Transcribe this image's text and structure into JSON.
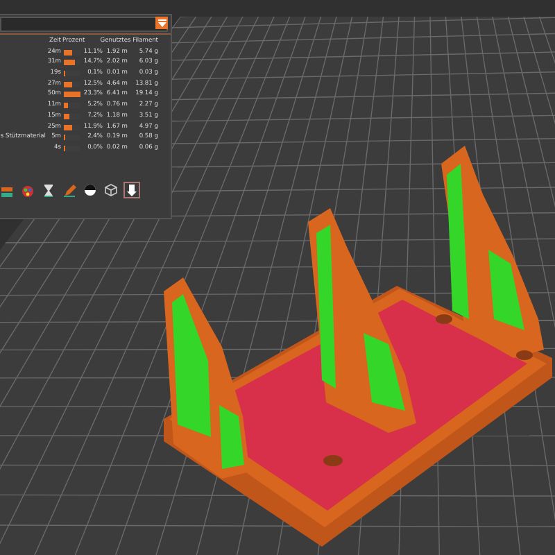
{
  "legend": {
    "columns": [
      "Zeit",
      "Prozent",
      "Genutztes Filament"
    ],
    "rows": [
      {
        "time": "24m",
        "level": 0.48,
        "percent": "11,1%",
        "length": "1.92 m",
        "weight": "5.74 g"
      },
      {
        "time": "31m",
        "level": 0.63,
        "percent": "14,7%",
        "length": "2.02 m",
        "weight": "6.03 g"
      },
      {
        "time": "19s",
        "level": 0.02,
        "percent": "0,1%",
        "length": "0.01 m",
        "weight": "0.03 g"
      },
      {
        "time": "27m",
        "level": 0.54,
        "percent": "12,5%",
        "length": "4.64 m",
        "weight": "13.81 g"
      },
      {
        "time": "50m",
        "level": 1.0,
        "percent": "23,3%",
        "length": "6.41 m",
        "weight": "19.14 g"
      },
      {
        "time": "11m",
        "level": 0.22,
        "percent": "5,2%",
        "length": "0.76 m",
        "weight": "2.27 g"
      },
      {
        "time": "15m",
        "level": 0.31,
        "percent": "7,2%",
        "length": "1.18 m",
        "weight": "3.51 g"
      },
      {
        "time": "25m",
        "level": 0.51,
        "percent": "11,9%",
        "length": "1.67 m",
        "weight": "4.97 g"
      },
      {
        "label": "s Stützmaterial",
        "time": "5m",
        "level": 0.1,
        "percent": "2,4%",
        "length": "0.19 m",
        "weight": "0.58 g"
      },
      {
        "time": "4s",
        "level": 0.02,
        "percent": "0,0%",
        "length": "0.02 m",
        "weight": "0.06 g"
      }
    ]
  },
  "toolbar": [
    {
      "kind": "layers"
    },
    {
      "kind": "palette"
    },
    {
      "kind": "hourglass"
    },
    {
      "kind": "pencil"
    },
    {
      "kind": "contrast"
    },
    {
      "kind": "cube"
    },
    {
      "kind": "export",
      "selected": true
    }
  ]
}
